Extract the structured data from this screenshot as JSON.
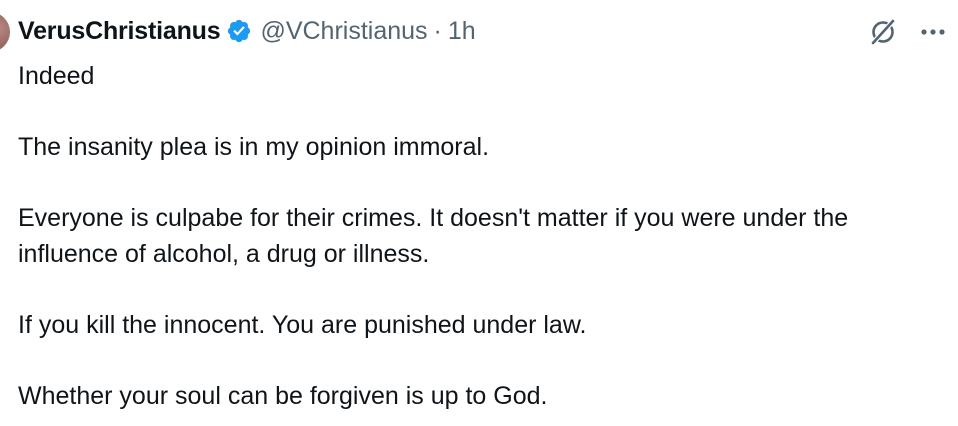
{
  "tweet": {
    "author": {
      "display_name": "VerusChristianus",
      "handle": "@VChristianus",
      "verified_icon": "verified-badge-icon",
      "verified_color": "#1d9bf0"
    },
    "separator": "·",
    "timestamp": "1h",
    "actions": {
      "grok_icon": "grok-icon",
      "more_icon": "more-options-icon"
    },
    "paragraphs": [
      "Indeed",
      "The insanity plea is in my opinion immoral.",
      "Everyone is culpabe for their crimes. It doesn't matter if you were under the influence of alcohol, a drug or illness.",
      "If you kill the innocent. You are punished under law.",
      "Whether your soul can be forgiven is up to God."
    ]
  },
  "colors": {
    "text_primary": "#0f1419",
    "text_secondary": "#536471",
    "background": "#ffffff"
  }
}
